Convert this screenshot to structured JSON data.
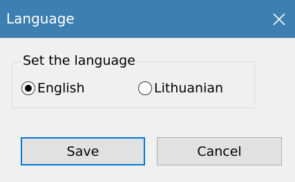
{
  "window": {
    "title": "Language",
    "close_icon": "close-icon"
  },
  "group": {
    "legend": "Set the language",
    "options": [
      {
        "label": "English",
        "selected": true
      },
      {
        "label": "Lithuanian",
        "selected": false
      }
    ]
  },
  "buttons": {
    "save_label": "Save",
    "cancel_label": "Cancel"
  },
  "colors": {
    "titlebar": "#3d7fb0",
    "default_button_border": "#0078d7"
  }
}
